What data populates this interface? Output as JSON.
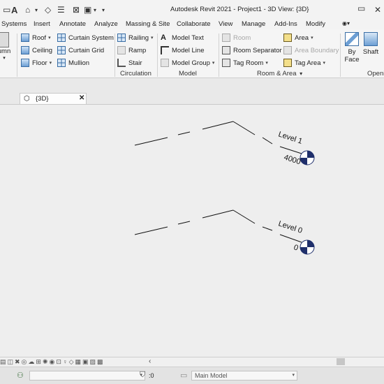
{
  "window": {
    "title": "Autodesk Revit 2021 - Project1 - 3D View: {3D}"
  },
  "tabs": [
    "Systems",
    "Insert",
    "Annotate",
    "Analyze",
    "Massing & Site",
    "Collaborate",
    "View",
    "Manage",
    "Add-Ins",
    "Modify"
  ],
  "ribbon": {
    "column_label": "umn",
    "build": {
      "roof": "Roof",
      "ceiling": "Ceiling",
      "floor": "Floor",
      "curtain_system": "Curtain System",
      "curtain_grid": "Curtain Grid",
      "mullion": "Mullion"
    },
    "circulation": {
      "railing": "Railing",
      "ramp": "Ramp",
      "stair": "Stair",
      "panel_label": "Circulation"
    },
    "model": {
      "model_text": "Model Text",
      "model_line": "Model Line",
      "model_group": "Model Group",
      "panel_label": "Model"
    },
    "room_area": {
      "room": "Room",
      "room_separator": "Room Separator",
      "tag_room": "Tag Room",
      "area": "Area",
      "area_boundary": "Area Boundary",
      "tag_area": "Tag Area",
      "panel_label": "Room & Area"
    },
    "opening": {
      "by_face": "By\nFace",
      "shaft": "Shaft",
      "panel_label": "Openi"
    }
  },
  "view": {
    "tab_label": "{3D}",
    "levels": [
      {
        "name": "Level 1",
        "elevation": "4000"
      },
      {
        "name": "Level 0",
        "elevation": "0"
      }
    ]
  },
  "status": {
    "workset_value": "",
    "selection_count": ":0",
    "model_selector": "Main Model"
  },
  "colors": {
    "level_head": "#1f2f6b",
    "ribbon_bg": "#f5f5f5",
    "canvas_bg": "#eeeeee"
  }
}
